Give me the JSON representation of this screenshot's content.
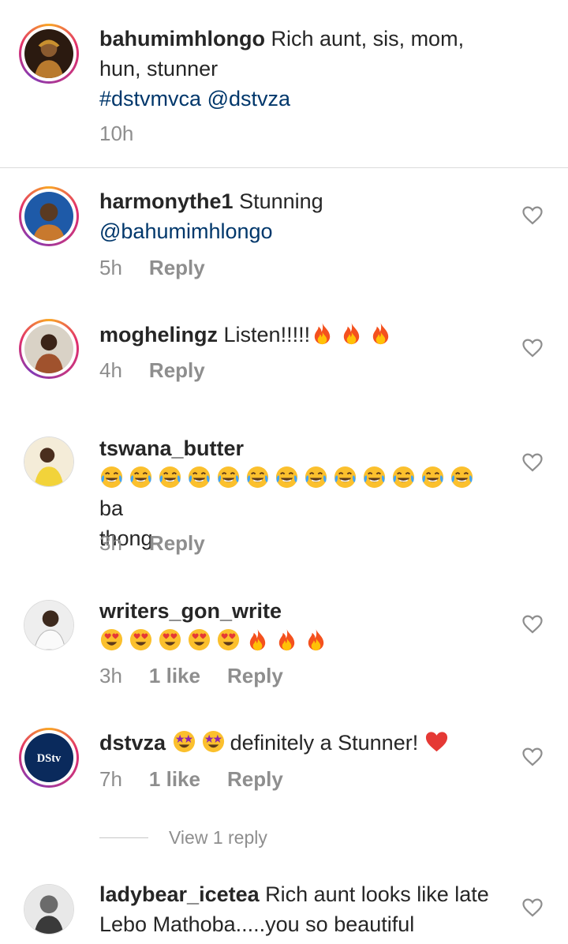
{
  "caption": {
    "username": "bahumimhlongo",
    "text": "Rich aunt, sis, mom, hun, stunner",
    "hashtag": "#dstvmvca",
    "mention": "@dstvza",
    "time": "10h"
  },
  "comments": [
    {
      "username": "harmonythe1",
      "text": "Stunning",
      "mention": "@bahumimhlongo",
      "time": "5h",
      "reply_label": "Reply"
    },
    {
      "username": "moghelingz",
      "text": "Listen!!!!!",
      "emojis": [
        "fire-emoji",
        "fire-emoji",
        "fire-emoji"
      ],
      "time": "4h",
      "reply_label": "Reply"
    },
    {
      "username": "tswana_butter",
      "emojis": [
        "tears-of-joy-emoji",
        "tears-of-joy-emoji",
        "tears-of-joy-emoji",
        "tears-of-joy-emoji",
        "tears-of-joy-emoji",
        "tears-of-joy-emoji",
        "tears-of-joy-emoji",
        "tears-of-joy-emoji",
        "tears-of-joy-emoji",
        "tears-of-joy-emoji",
        "tears-of-joy-emoji",
        "tears-of-joy-emoji",
        "tears-of-joy-emoji"
      ],
      "text_after": "ba",
      "text_line2": "thong",
      "time": "3h",
      "reply_label": "Reply"
    },
    {
      "username": "writers_gon_write",
      "emojis": [
        "heart-eyes-emoji",
        "heart-eyes-emoji",
        "heart-eyes-emoji",
        "heart-eyes-emoji",
        "heart-eyes-emoji",
        "fire-emoji",
        "fire-emoji",
        "fire-emoji"
      ],
      "time": "3h",
      "likes": "1 like",
      "reply_label": "Reply"
    },
    {
      "username": "dstvza",
      "emojis": [
        "star-struck-emoji",
        "star-struck-emoji"
      ],
      "text": "definitely a Stunner!",
      "trailing_emoji": "red-heart-emoji",
      "avatar_logo": "DStv",
      "time": "7h",
      "likes": "1 like",
      "reply_label": "Reply"
    },
    {
      "username": "ladybear_icetea",
      "text": "Rich aunt looks like late Lebo Mathoba.....you so beautiful"
    }
  ],
  "view_replies_label": "View 1 reply",
  "colors": {
    "text": "#262626",
    "muted": "#8e8e8e",
    "link": "#00376b",
    "divider": "#dbdbdb",
    "story_ring": "#e1306c",
    "dstv_blue": "#0a2a5c"
  }
}
